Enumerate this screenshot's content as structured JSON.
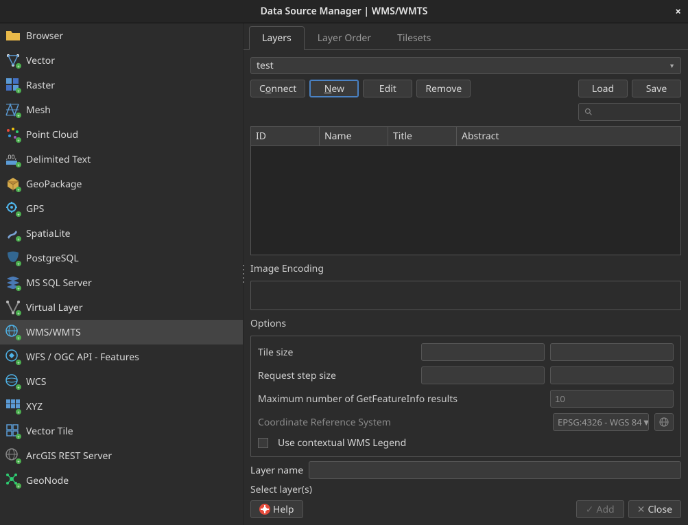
{
  "window": {
    "title": "Data Source Manager | WMS/WMTS"
  },
  "sidebar": {
    "items": [
      {
        "label": "Browser",
        "icon": "folder",
        "selected": false
      },
      {
        "label": "Vector",
        "icon": "vector",
        "selected": false
      },
      {
        "label": "Raster",
        "icon": "raster",
        "selected": false
      },
      {
        "label": "Mesh",
        "icon": "mesh",
        "selected": false
      },
      {
        "label": "Point Cloud",
        "icon": "pointcloud",
        "selected": false
      },
      {
        "label": "Delimited Text",
        "icon": "csv",
        "selected": false
      },
      {
        "label": "GeoPackage",
        "icon": "gpkg",
        "selected": false
      },
      {
        "label": "GPS",
        "icon": "gps",
        "selected": false
      },
      {
        "label": "SpatiaLite",
        "icon": "spatialite",
        "selected": false
      },
      {
        "label": "PostgreSQL",
        "icon": "postgres",
        "selected": false
      },
      {
        "label": "MS SQL Server",
        "icon": "mssql",
        "selected": false
      },
      {
        "label": "Virtual Layer",
        "icon": "virtual",
        "selected": false
      },
      {
        "label": "WMS/WMTS",
        "icon": "wms",
        "selected": true
      },
      {
        "label": "WFS / OGC API - Features",
        "icon": "wfs",
        "selected": false
      },
      {
        "label": "WCS",
        "icon": "wcs",
        "selected": false
      },
      {
        "label": "XYZ",
        "icon": "xyz",
        "selected": false
      },
      {
        "label": "Vector Tile",
        "icon": "vtile",
        "selected": false
      },
      {
        "label": "ArcGIS REST Server",
        "icon": "arcgis",
        "selected": false
      },
      {
        "label": "GeoNode",
        "icon": "geonode",
        "selected": false
      }
    ]
  },
  "tabs": [
    {
      "label": "Layers",
      "active": true
    },
    {
      "label": "Layer Order",
      "active": false
    },
    {
      "label": "Tilesets",
      "active": false
    }
  ],
  "connection": {
    "selected": "test"
  },
  "buttons": {
    "connect": "Connect",
    "new": "New",
    "edit": "Edit",
    "remove": "Remove",
    "load": "Load",
    "save": "Save"
  },
  "table": {
    "columns": [
      "ID",
      "Name",
      "Title",
      "Abstract"
    ]
  },
  "section_image_encoding": "Image Encoding",
  "section_options": "Options",
  "options": {
    "tile_size": "Tile size",
    "request_step": "Request step size",
    "max_featureinfo": "Maximum number of GetFeatureInfo results",
    "max_featureinfo_value": "10",
    "crs_label": "Coordinate Reference System",
    "crs_value": "EPSG:4326 - WGS 84",
    "contextual_legend": "Use contextual WMS Legend"
  },
  "footer": {
    "layer_name_label": "Layer name",
    "status": "Select layer(s)",
    "help": "Help",
    "add": "Add",
    "close": "Close"
  }
}
